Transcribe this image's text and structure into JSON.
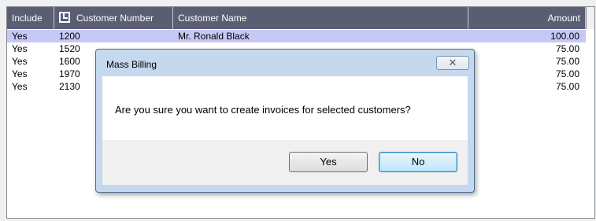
{
  "grid": {
    "columns": [
      {
        "label": "Include",
        "align": "left"
      },
      {
        "label": "Customer Number",
        "align": "left",
        "icon": "edit-box-icon"
      },
      {
        "label": "Customer Name",
        "align": "left"
      },
      {
        "label": "Amount",
        "align": "right"
      }
    ],
    "rows": [
      {
        "include": "Yes",
        "number": "1200",
        "name": "Mr. Ronald Black",
        "amount": "100.00",
        "selected": true
      },
      {
        "include": "Yes",
        "number": "1520",
        "name": "",
        "amount": "75.00",
        "selected": false
      },
      {
        "include": "Yes",
        "number": "1600",
        "name": "",
        "amount": "75.00",
        "selected": false
      },
      {
        "include": "Yes",
        "number": "1970",
        "name": "",
        "amount": "75.00",
        "selected": false
      },
      {
        "include": "Yes",
        "number": "2130",
        "name": "",
        "amount": "75.00",
        "selected": false
      }
    ]
  },
  "dialog": {
    "title": "Mass Billing",
    "close_icon": "close-icon",
    "message": "Are you sure you want to create invoices for selected customers?",
    "yes_label": "Yes",
    "no_label": "No"
  },
  "colors": {
    "header_bg": "#5b5e73",
    "selected_row_bg": "#c6c8f5",
    "dialog_frame": "#c5d8ee"
  }
}
